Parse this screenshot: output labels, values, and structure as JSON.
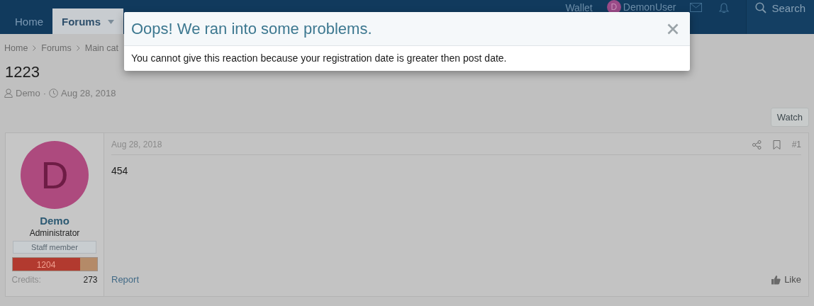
{
  "nav": {
    "tabs": [
      {
        "label": "Home",
        "selected": false,
        "menu": false
      },
      {
        "label": "Forums",
        "selected": true,
        "menu": true
      }
    ],
    "account": {
      "wallet": "Wallet",
      "avatar_letter": "D",
      "username": "DemonUser"
    },
    "search": {
      "label": "Search"
    }
  },
  "breadcrumb": [
    "Home",
    "Forums",
    "Main cat"
  ],
  "thread": {
    "title": "1223",
    "author": "Demo",
    "separator": "·",
    "date": "Aug 28, 2018"
  },
  "watch_button": "Watch",
  "post": {
    "user": {
      "avatar_letter": "D",
      "name": "Demo",
      "title": "Administrator",
      "banner": "Staff member",
      "progress_label": "1204",
      "level": 0.8,
      "credits_label": "Credits:",
      "credits": "273"
    },
    "date": "Aug 28, 2018",
    "number": "#1",
    "body": "454",
    "report": "Report",
    "like": "Like"
  },
  "modal": {
    "title": "Oops! We ran into some problems.",
    "message": "You cannot give this reaction because your registration date is greater then post date."
  }
}
